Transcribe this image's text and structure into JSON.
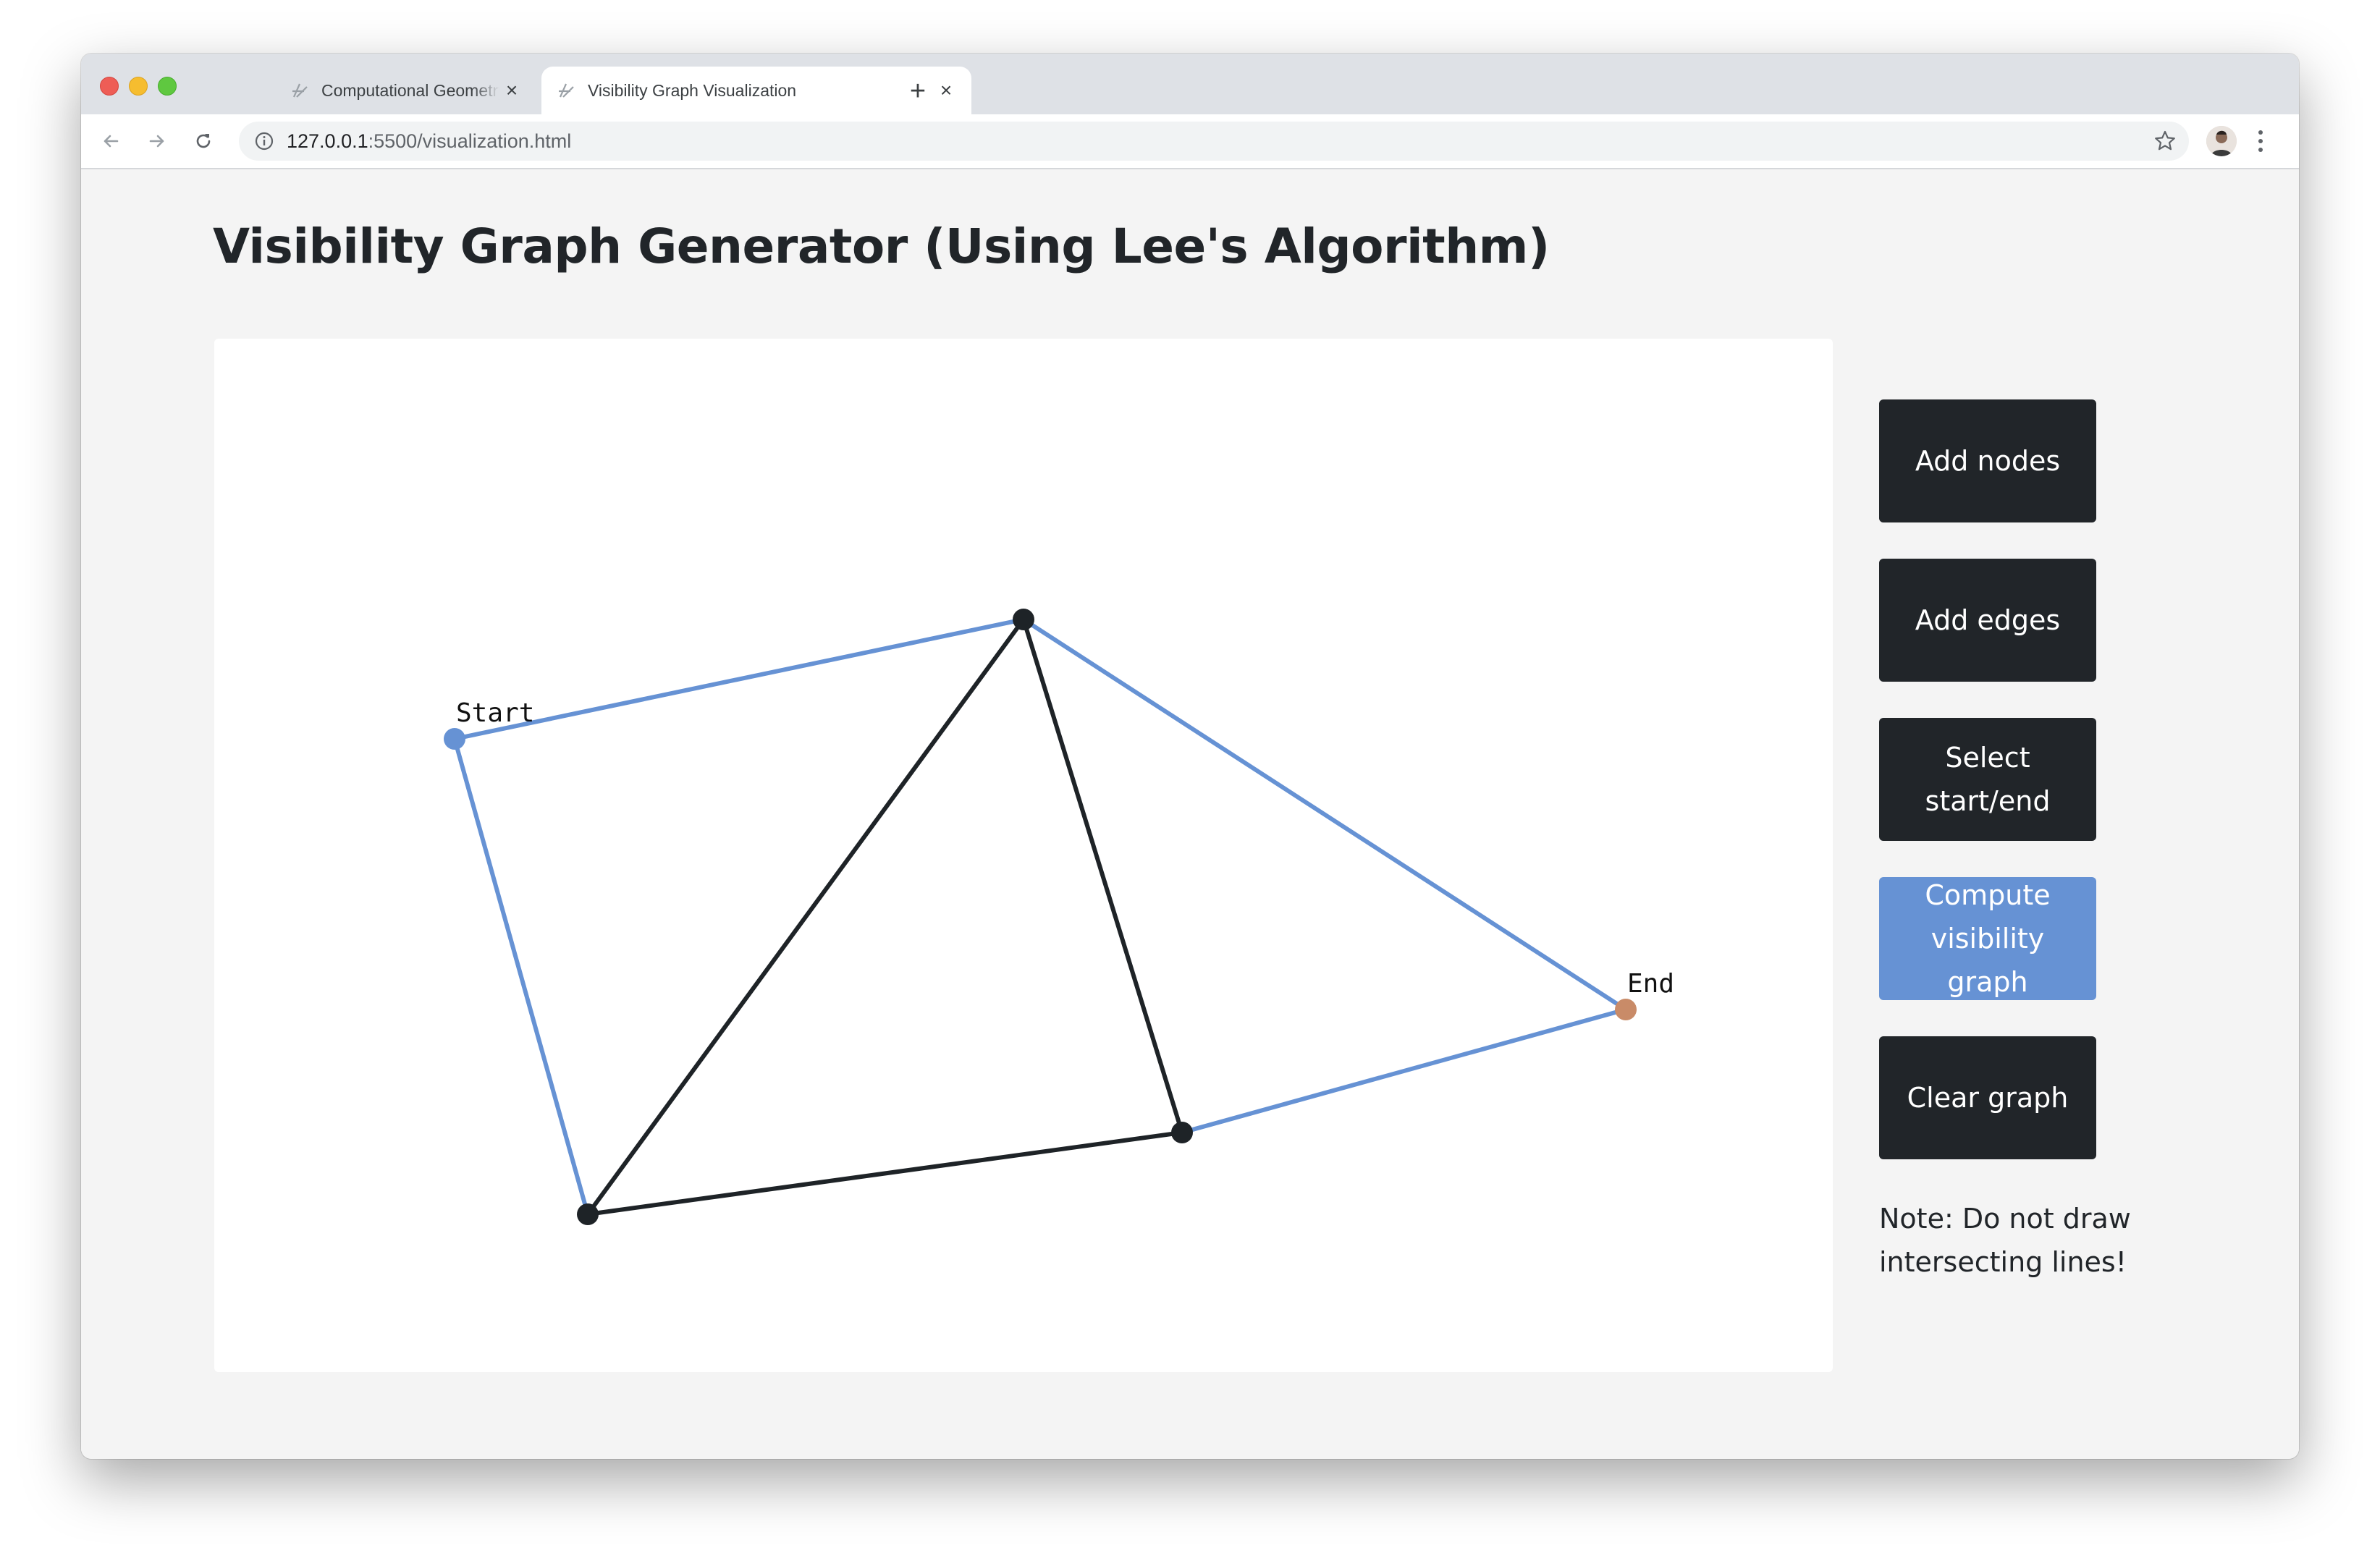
{
  "browser": {
    "tabs": [
      {
        "title": "Computational Geometry and Vis",
        "active": false
      },
      {
        "title": "Visibility Graph Visualization",
        "active": true
      }
    ],
    "new_tab_label": "+",
    "close_label": "×",
    "url_host": "127.0.0.1",
    "url_path": ":5500/visualization.html"
  },
  "page": {
    "title": "Visibility Graph Generator (Using Lee's Algorithm)",
    "buttons": [
      {
        "id": "add-nodes",
        "label": "Add nodes",
        "active": false
      },
      {
        "id": "add-edges",
        "label": "Add edges",
        "active": false
      },
      {
        "id": "select-start-end",
        "label": "Select start/end",
        "active": false
      },
      {
        "id": "compute-visibility-graph",
        "label": "Compute visibility graph",
        "active": true
      },
      {
        "id": "clear-graph",
        "label": "Clear graph",
        "active": false
      }
    ],
    "note": "Note: Do not draw intersecting lines!"
  },
  "graph": {
    "nodes": [
      {
        "id": "start",
        "label": "Start",
        "role": "start"
      },
      {
        "id": "top",
        "label": "",
        "role": "obstacle"
      },
      {
        "id": "bottom-left",
        "label": "",
        "role": "obstacle"
      },
      {
        "id": "bottom-right",
        "label": "",
        "role": "obstacle"
      },
      {
        "id": "end",
        "label": "End",
        "role": "end"
      }
    ],
    "obstacle_edges": [
      [
        "top",
        "bottom-left"
      ],
      [
        "top",
        "bottom-right"
      ],
      [
        "bottom-left",
        "bottom-right"
      ]
    ],
    "visibility_edges": [
      [
        "start",
        "top"
      ],
      [
        "start",
        "bottom-left"
      ],
      [
        "top",
        "end"
      ],
      [
        "bottom-right",
        "end"
      ]
    ]
  },
  "colors": {
    "start_node": "#6692d4",
    "end_node": "#c98b68",
    "obstacle": "#1e2327",
    "visibility_edge": "#6692d4",
    "button_dark": "#212529",
    "button_active": "#6692d4"
  }
}
